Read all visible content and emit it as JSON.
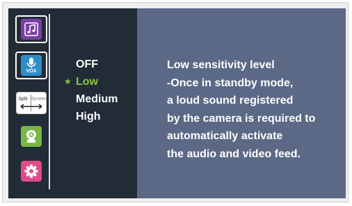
{
  "sidebar": {
    "items": [
      {
        "name": "music",
        "icon": "music-note-icon",
        "color": "#7b3fa0"
      },
      {
        "name": "vox",
        "icon": "microphone-icon",
        "label": "VOX",
        "color": "#2f8ec9"
      },
      {
        "name": "split-screen",
        "icon": "split-screen-icon",
        "label_split": "Split",
        "label_screen": "Screen"
      },
      {
        "name": "camera",
        "icon": "camera-icon",
        "color": "#7ab648"
      },
      {
        "name": "settings",
        "icon": "gear-icon",
        "color": "#e04a89"
      }
    ],
    "selected": "vox"
  },
  "menu": {
    "options": [
      "OFF",
      "Low",
      "Medium",
      "High"
    ],
    "selected": "Low",
    "selected_marker": "★"
  },
  "description": {
    "lines": [
      "Low sensitivity level",
      "-Once in standby mode,",
      "a loud sound registered",
      "by the camera is required to",
      "automatically activate",
      "the audio and video feed."
    ]
  },
  "colors": {
    "screen_bg": "#212c37",
    "panel_bg": "#5b6986",
    "highlight": "#8ec63f"
  }
}
